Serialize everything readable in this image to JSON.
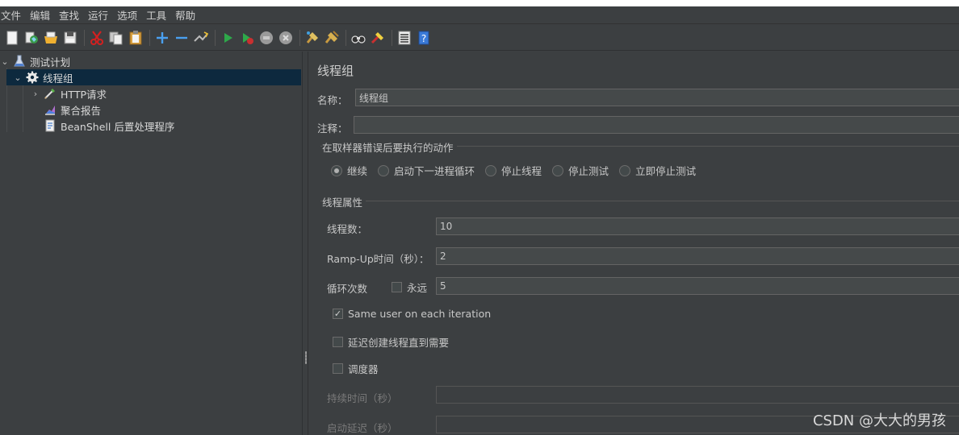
{
  "menubar": {
    "items": [
      "文件",
      "编辑",
      "查找",
      "运行",
      "选项",
      "工具",
      "帮助"
    ]
  },
  "toolbar": {
    "icons": [
      "new-icon",
      "templates-icon",
      "open-icon",
      "save-icon",
      "cut-icon",
      "copy-icon",
      "paste-icon",
      "expand-icon",
      "collapse-icon",
      "toggle-icon",
      "start-icon",
      "start-no-pause-icon",
      "stop-icon",
      "shutdown-icon",
      "clear-icon",
      "clear-all-icon",
      "search-icon",
      "reset-search-icon",
      "function-helper-icon",
      "help-icon"
    ]
  },
  "tree": {
    "items": [
      {
        "label": "测试计划",
        "icon": "test-plan-icon",
        "expanded": true
      },
      {
        "label": "线程组",
        "icon": "thread-group-gear-icon",
        "expanded": true,
        "selected": true
      },
      {
        "label": "HTTP请求",
        "icon": "http-sampler-pen-icon",
        "expanded": false
      },
      {
        "label": "聚合报告",
        "icon": "aggregate-report-chart-icon"
      },
      {
        "label": "BeanShell 后置处理程序",
        "icon": "beanshell-script-icon"
      }
    ]
  },
  "panel": {
    "title": "线程组",
    "name_label": "名称：",
    "name_value": "线程组",
    "comment_label": "注释：",
    "comment_value": "",
    "error_group_title": "在取样器错误后要执行的动作",
    "error_actions": [
      {
        "label": "继续",
        "selected": true
      },
      {
        "label": "启动下一进程循环",
        "selected": false
      },
      {
        "label": "停止线程",
        "selected": false
      },
      {
        "label": "停止测试",
        "selected": false
      },
      {
        "label": "立即停止测试",
        "selected": false
      }
    ],
    "props_group_title": "线程属性",
    "threads_label": "线程数：",
    "threads_value": "10",
    "rampup_label": "Ramp-Up时间（秒）：",
    "rampup_value": "2",
    "loop_label": "循环次数",
    "forever_label": "永远",
    "forever_checked": false,
    "loop_value": "5",
    "same_user_label": "Same user on each iteration",
    "same_user_checked": true,
    "delay_create_label": "延迟创建线程直到需要",
    "delay_create_checked": false,
    "scheduler_label": "调度器",
    "scheduler_checked": false,
    "duration_label": "持续时间（秒）",
    "duration_value": "",
    "startup_delay_label": "启动延迟（秒）",
    "startup_delay_value": ""
  },
  "watermark": "CSDN @大大的男孩"
}
